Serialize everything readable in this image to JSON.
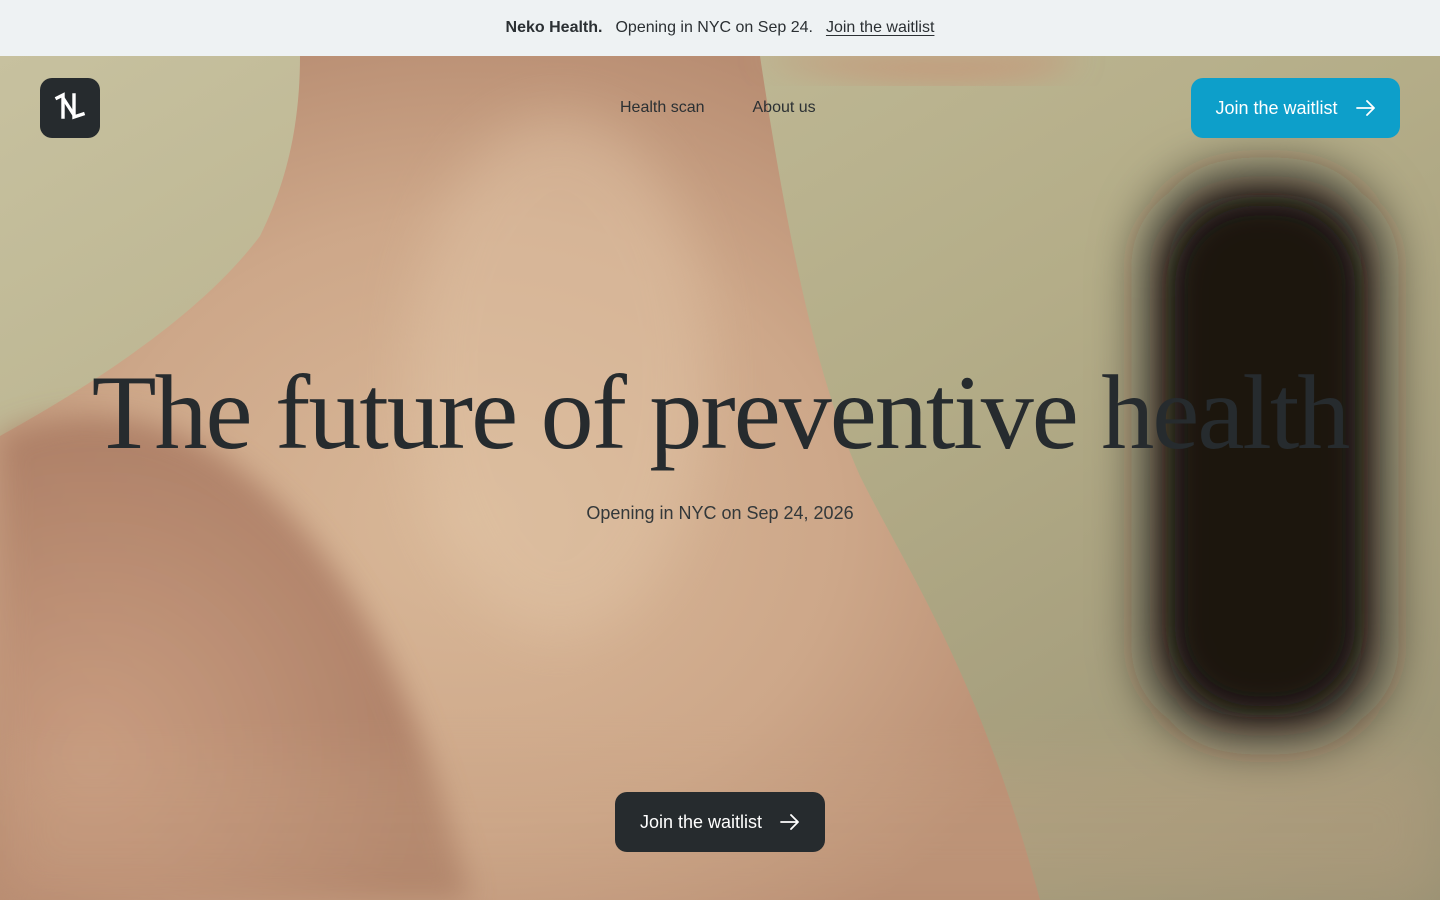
{
  "announcement": {
    "brand": "Neko Health.",
    "message": "Opening in NYC on Sep 24.",
    "link_label": "Join the waitlist"
  },
  "nav": {
    "logo_icon": "neko-logo-icon",
    "items": [
      {
        "label": "Health scan"
      },
      {
        "label": "About us"
      }
    ],
    "cta_label": "Join the waitlist",
    "cta_icon": "arrow-right-icon"
  },
  "hero": {
    "headline": "The future of preventive health",
    "subline": "Opening in NYC on Sep 24, 2026",
    "cta_label": "Join the waitlist",
    "cta_icon": "arrow-right-icon"
  },
  "colors": {
    "announcement_bg": "#eef2f3",
    "accent": "#0d9fca",
    "dark": "#262b2e",
    "text_on_button": "#ffffff"
  }
}
